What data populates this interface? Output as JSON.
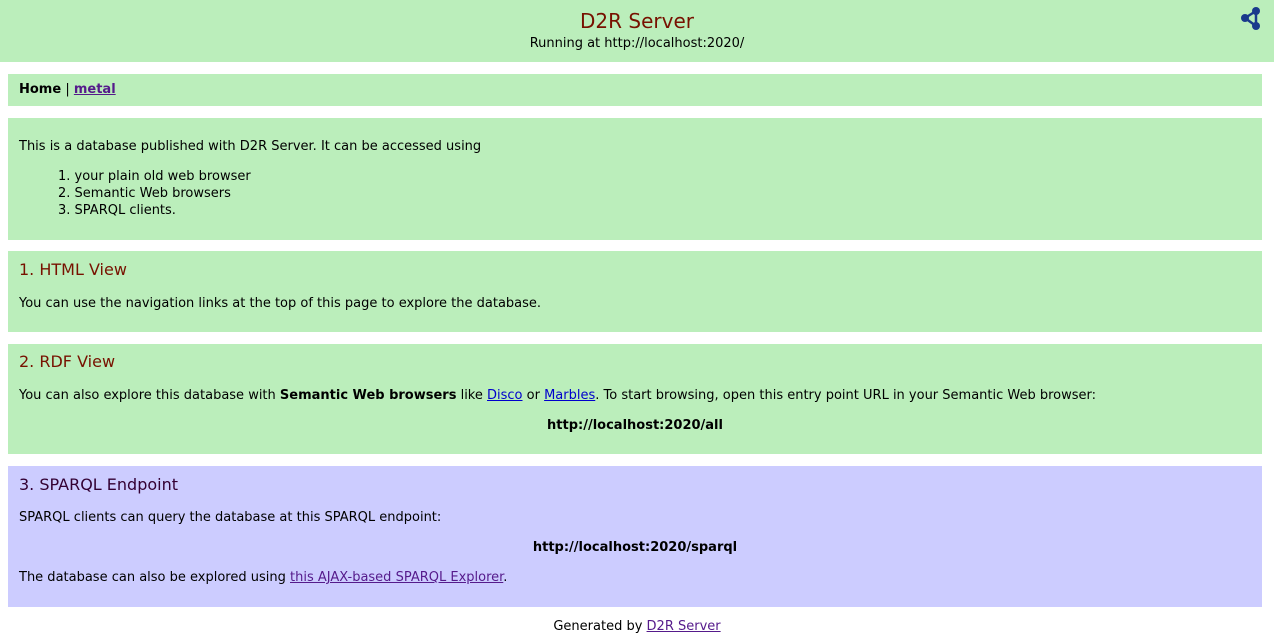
{
  "header": {
    "title": "D2R Server",
    "subtitle": "Running at http://localhost:2020/",
    "share_icon": "share-icon"
  },
  "nav": {
    "home": "Home",
    "separator": "|",
    "metal": "metal"
  },
  "intro": {
    "text": "This is a database published with D2R Server. It can be accessed using",
    "items": [
      "1. your plain old web browser",
      "2. Semantic Web browsers",
      "3. SPARQL clients."
    ]
  },
  "html_view": {
    "heading": "1. HTML View",
    "text": "You can use the navigation links at the top of this page to explore the database."
  },
  "rdf_view": {
    "heading": "2. RDF View",
    "text_before": "You can also explore this database with ",
    "bold": "Semantic Web browsers",
    "like": " like ",
    "disco": "Disco",
    "or": " or ",
    "marbles": "Marbles",
    "text_after": ". To start browsing, open this entry point URL in your Semantic Web browser:",
    "url": "http://localhost:2020/all"
  },
  "sparql": {
    "heading": "3. SPARQL Endpoint",
    "text": "SPARQL clients can query the database at this SPARQL endpoint:",
    "url": "http://localhost:2020/sparql",
    "explorer_before": "The database can also be explored using ",
    "explorer_link": "this AJAX-based SPARQL Explorer",
    "explorer_after": "."
  },
  "footer": {
    "generated_by": "Generated by ",
    "link": "D2R Server"
  },
  "colors": {
    "green_bg": "#bbeebb",
    "blue_bg": "#ccccff",
    "heading": "#771100"
  }
}
